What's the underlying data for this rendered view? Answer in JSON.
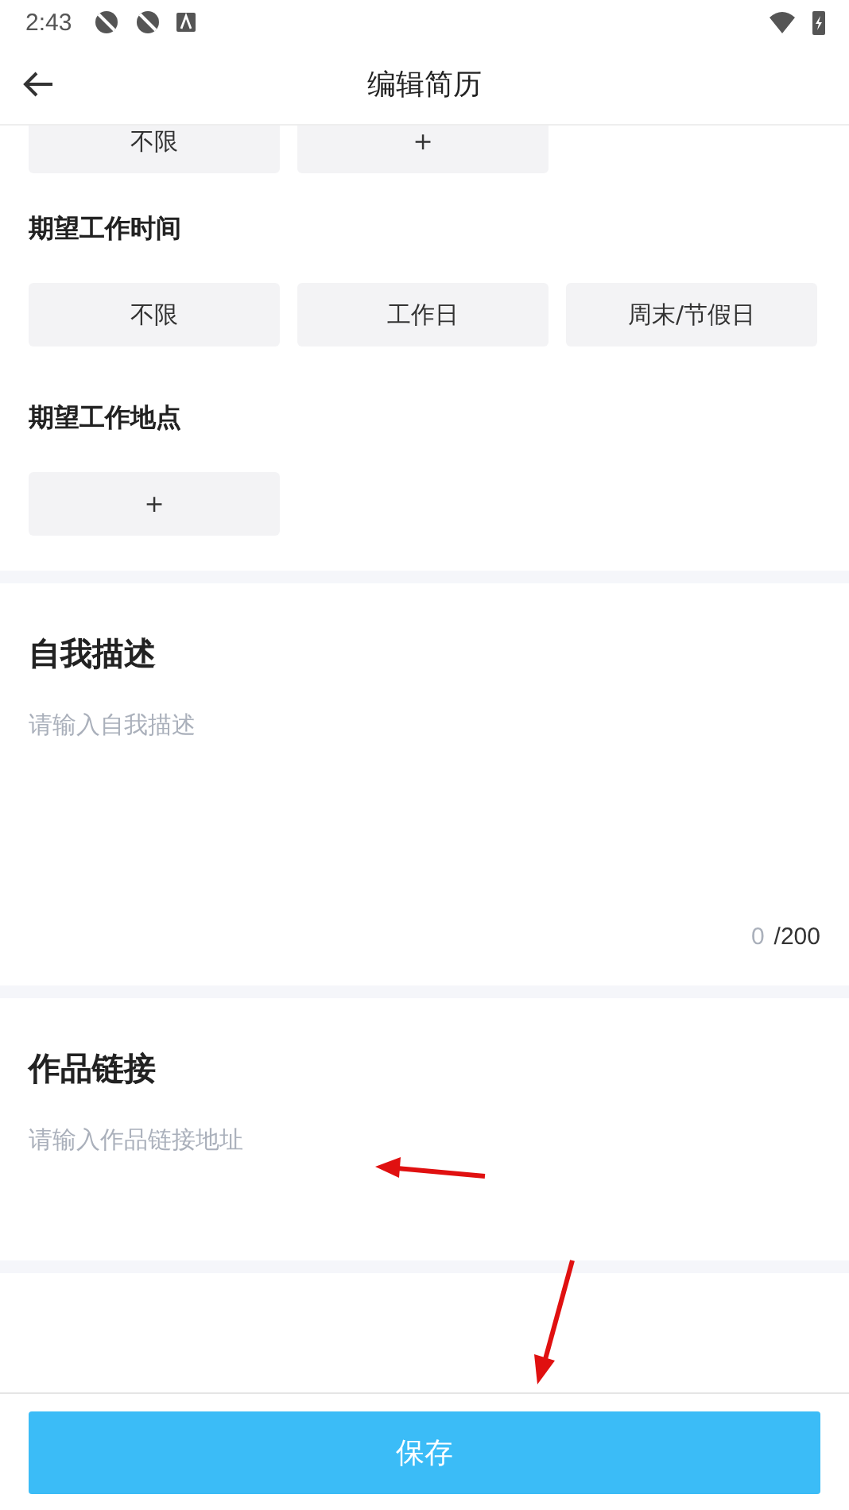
{
  "status_bar": {
    "time": "2:43"
  },
  "header": {
    "title": "编辑简历"
  },
  "option_groups": [
    {
      "options": [
        "不限",
        "+"
      ]
    },
    {
      "title": "期望工作时间",
      "options": [
        "不限",
        "工作日",
        "周末/节假日"
      ]
    },
    {
      "title": "期望工作地点",
      "options": [
        "+"
      ]
    }
  ],
  "self_description": {
    "title": "自我描述",
    "placeholder": "请输入自我描述",
    "count": "0",
    "max": "/200"
  },
  "portfolio_link": {
    "title": "作品链接",
    "placeholder": "请输入作品链接地址"
  },
  "save_button": "保存"
}
